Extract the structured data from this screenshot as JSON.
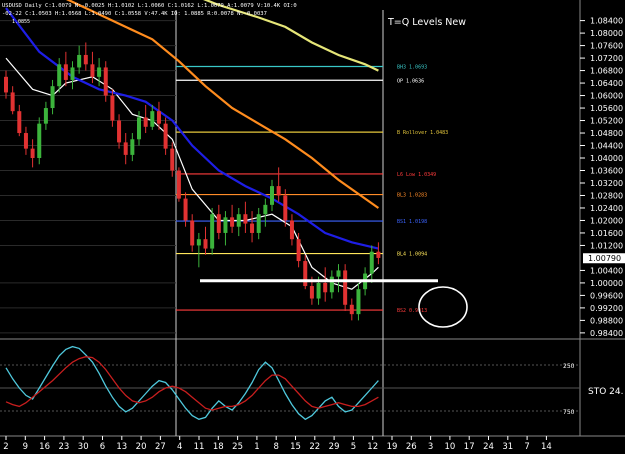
{
  "header": {
    "symbol_line": "USDUSD Daily C:1.0079 N:-0.0025 H:1.0102 L:1.0060 C:1.0162 L:1.0079 A:1.0079 V:10.4K OI:0",
    "bar_line": "-02-22 C:1.0503 H:1.0568 L:1.0490 C:1.0558 V:47.4K IO: 1.0885 R:0.0078 N:-0.0037",
    "top_left_value": "1.0855",
    "indicator_title": "T=Q Levels New"
  },
  "colors": {
    "background": "#000000",
    "up_candle": "#3cb43c",
    "down_candle": "#e13232",
    "ma_fast": "#ffffff",
    "ma_mid": "#1e1ee6",
    "ma_slow": "#ff8c1e",
    "ma_slowest": "#e6e678",
    "stoch_k": "#4fc8dc",
    "stoch_d": "#c81e1e",
    "support_line": "#ffffff",
    "circle": "#ffffff"
  },
  "chart_data": [
    {
      "type": "candlestick",
      "title": "",
      "ylim": [
        0.983,
        1.0906
      ],
      "y_ticks": [
        "1.08400",
        "1.08000",
        "1.07600",
        "1.07200",
        "1.06800",
        "1.06400",
        "1.06000",
        "1.05600",
        "1.05200",
        "1.04800",
        "1.04400",
        "1.04000",
        "1.03600",
        "1.03200",
        "1.02800",
        "1.02400",
        "1.02000",
        "1.01600",
        "1.01200",
        "1.00400",
        "1.00000",
        "0.99600",
        "0.99200",
        "0.98800",
        "0.98400"
      ],
      "y_tick_values": [
        1.084,
        1.08,
        1.076,
        1.072,
        1.068,
        1.064,
        1.06,
        1.056,
        1.052,
        1.048,
        1.044,
        1.04,
        1.036,
        1.032,
        1.028,
        1.024,
        1.02,
        1.016,
        1.012,
        1.004,
        1.0,
        0.996,
        0.992,
        0.988,
        0.984
      ],
      "last_price_label": "1.00790",
      "last_price": 1.0079,
      "candles": [
        {
          "o": 1.066,
          "h": 1.068,
          "l": 1.059,
          "c": 1.061
        },
        {
          "o": 1.061,
          "h": 1.063,
          "l": 1.054,
          "c": 1.055
        },
        {
          "o": 1.055,
          "h": 1.057,
          "l": 1.047,
          "c": 1.048
        },
        {
          "o": 1.048,
          "h": 1.05,
          "l": 1.041,
          "c": 1.043
        },
        {
          "o": 1.043,
          "h": 1.046,
          "l": 1.037,
          "c": 1.04
        },
        {
          "o": 1.04,
          "h": 1.053,
          "l": 1.038,
          "c": 1.051
        },
        {
          "o": 1.051,
          "h": 1.058,
          "l": 1.049,
          "c": 1.056
        },
        {
          "o": 1.056,
          "h": 1.065,
          "l": 1.054,
          "c": 1.063
        },
        {
          "o": 1.063,
          "h": 1.072,
          "l": 1.061,
          "c": 1.07
        },
        {
          "o": 1.07,
          "h": 1.074,
          "l": 1.063,
          "c": 1.065
        },
        {
          "o": 1.065,
          "h": 1.071,
          "l": 1.062,
          "c": 1.069
        },
        {
          "o": 1.069,
          "h": 1.076,
          "l": 1.067,
          "c": 1.073
        },
        {
          "o": 1.073,
          "h": 1.077,
          "l": 1.068,
          "c": 1.07
        },
        {
          "o": 1.07,
          "h": 1.074,
          "l": 1.064,
          "c": 1.066
        },
        {
          "o": 1.066,
          "h": 1.072,
          "l": 1.063,
          "c": 1.069
        },
        {
          "o": 1.069,
          "h": 1.071,
          "l": 1.058,
          "c": 1.06
        },
        {
          "o": 1.06,
          "h": 1.062,
          "l": 1.05,
          "c": 1.052
        },
        {
          "o": 1.052,
          "h": 1.054,
          "l": 1.043,
          "c": 1.045
        },
        {
          "o": 1.045,
          "h": 1.048,
          "l": 1.038,
          "c": 1.041
        },
        {
          "o": 1.041,
          "h": 1.048,
          "l": 1.039,
          "c": 1.046
        },
        {
          "o": 1.046,
          "h": 1.055,
          "l": 1.044,
          "c": 1.053
        },
        {
          "o": 1.053,
          "h": 1.057,
          "l": 1.048,
          "c": 1.05
        },
        {
          "o": 1.05,
          "h": 1.057,
          "l": 1.049,
          "c": 1.055
        },
        {
          "o": 1.055,
          "h": 1.058,
          "l": 1.049,
          "c": 1.051
        },
        {
          "o": 1.051,
          "h": 1.053,
          "l": 1.041,
          "c": 1.043
        },
        {
          "o": 1.043,
          "h": 1.045,
          "l": 1.034,
          "c": 1.036
        },
        {
          "o": 1.036,
          "h": 1.037,
          "l": 1.026,
          "c": 1.027
        },
        {
          "o": 1.027,
          "h": 1.029,
          "l": 1.018,
          "c": 1.02
        },
        {
          "o": 1.02,
          "h": 1.022,
          "l": 1.01,
          "c": 1.012
        },
        {
          "o": 1.012,
          "h": 1.016,
          "l": 1.005,
          "c": 1.014
        },
        {
          "o": 1.014,
          "h": 1.018,
          "l": 1.009,
          "c": 1.011
        },
        {
          "o": 1.011,
          "h": 1.024,
          "l": 1.009,
          "c": 1.022
        },
        {
          "o": 1.022,
          "h": 1.025,
          "l": 1.014,
          "c": 1.016
        },
        {
          "o": 1.016,
          "h": 1.023,
          "l": 1.012,
          "c": 1.021
        },
        {
          "o": 1.021,
          "h": 1.025,
          "l": 1.016,
          "c": 1.018
        },
        {
          "o": 1.018,
          "h": 1.024,
          "l": 1.015,
          "c": 1.022
        },
        {
          "o": 1.022,
          "h": 1.026,
          "l": 1.016,
          "c": 1.019
        },
        {
          "o": 1.019,
          "h": 1.023,
          "l": 1.013,
          "c": 1.016
        },
        {
          "o": 1.016,
          "h": 1.024,
          "l": 1.014,
          "c": 1.022
        },
        {
          "o": 1.022,
          "h": 1.027,
          "l": 1.018,
          "c": 1.025
        },
        {
          "o": 1.025,
          "h": 1.033,
          "l": 1.023,
          "c": 1.031
        },
        {
          "o": 1.031,
          "h": 1.037,
          "l": 1.026,
          "c": 1.028
        },
        {
          "o": 1.028,
          "h": 1.03,
          "l": 1.018,
          "c": 1.02
        },
        {
          "o": 1.02,
          "h": 1.022,
          "l": 1.012,
          "c": 1.014
        },
        {
          "o": 1.014,
          "h": 1.016,
          "l": 1.005,
          "c": 1.007
        },
        {
          "o": 1.007,
          "h": 1.009,
          "l": 0.998,
          "c": 0.999
        },
        {
          "o": 0.999,
          "h": 1.002,
          "l": 0.993,
          "c": 0.995
        },
        {
          "o": 0.995,
          "h": 1.002,
          "l": 0.993,
          "c": 1.0
        },
        {
          "o": 1.0,
          "h": 1.005,
          "l": 0.994,
          "c": 0.997
        },
        {
          "o": 0.997,
          "h": 1.004,
          "l": 0.995,
          "c": 1.002
        },
        {
          "o": 1.002,
          "h": 1.006,
          "l": 0.997,
          "c": 1.004
        },
        {
          "o": 1.004,
          "h": 1.006,
          "l": 0.991,
          "c": 0.993
        },
        {
          "o": 0.993,
          "h": 0.995,
          "l": 0.988,
          "c": 0.99
        },
        {
          "o": 0.99,
          "h": 1.0,
          "l": 0.988,
          "c": 0.998
        },
        {
          "o": 0.998,
          "h": 1.005,
          "l": 0.996,
          "c": 1.003
        },
        {
          "o": 1.003,
          "h": 1.012,
          "l": 1.0,
          "c": 1.01
        },
        {
          "o": 1.01,
          "h": 1.013,
          "l": 1.006,
          "c": 1.008
        }
      ],
      "moving_averages": [
        {
          "name": "",
          "color_key": "ma_fast",
          "points": [
            [
              0,
              1.072
            ],
            [
              4,
              1.062
            ],
            [
              7,
              1.06
            ],
            [
              9,
              1.064
            ],
            [
              13,
              1.066
            ],
            [
              16,
              1.062
            ],
            [
              19,
              1.054
            ],
            [
              22,
              1.052
            ],
            [
              25,
              1.046
            ],
            [
              28,
              1.03
            ],
            [
              32,
              1.02
            ],
            [
              36,
              1.02
            ],
            [
              40,
              1.022
            ],
            [
              43,
              1.018
            ],
            [
              46,
              1.005
            ],
            [
              49,
              1.0
            ],
            [
              52,
              0.998
            ],
            [
              55,
              1.003
            ],
            [
              56,
              1.005
            ]
          ]
        },
        {
          "name": "",
          "color_key": "ma_mid",
          "points": [
            [
              0,
              1.088
            ],
            [
              5,
              1.074
            ],
            [
              10,
              1.066
            ],
            [
              14,
              1.062
            ],
            [
              18,
              1.06
            ],
            [
              21,
              1.058
            ],
            [
              25,
              1.052
            ],
            [
              28,
              1.044
            ],
            [
              32,
              1.036
            ],
            [
              36,
              1.031
            ],
            [
              40,
              1.027
            ],
            [
              44,
              1.022
            ],
            [
              48,
              1.016
            ],
            [
              52,
              1.013
            ],
            [
              56,
              1.011
            ]
          ]
        },
        {
          "name": "",
          "color_key": "ma_slow",
          "points": [
            [
              0,
              1.1
            ],
            [
              6,
              1.094
            ],
            [
              12,
              1.088
            ],
            [
              18,
              1.082
            ],
            [
              22,
              1.078
            ],
            [
              26,
              1.071
            ],
            [
              30,
              1.063
            ],
            [
              34,
              1.056
            ],
            [
              38,
              1.051
            ],
            [
              42,
              1.046
            ],
            [
              46,
              1.04
            ],
            [
              50,
              1.033
            ],
            [
              54,
              1.027
            ],
            [
              56,
              1.024
            ]
          ]
        },
        {
          "name": "",
          "color_key": "ma_slowest",
          "points": [
            [
              26,
              1.094
            ],
            [
              32,
              1.089
            ],
            [
              38,
              1.085
            ],
            [
              42,
              1.082
            ],
            [
              46,
              1.077
            ],
            [
              50,
              1.073
            ],
            [
              54,
              1.07
            ],
            [
              56,
              1.068
            ]
          ]
        }
      ],
      "support_level": 1.0007,
      "levels": [
        {
          "label": "BH3 1.0693",
          "value": 1.0693,
          "color": "#39c8c8"
        },
        {
          "label": "OP 1.0636",
          "value": 1.0649,
          "color": "#ffffff"
        },
        {
          "label": "B Rollover 1.0483",
          "value": 1.0483,
          "color": "#e6c83c"
        },
        {
          "label": "L6 Low 1.0349",
          "value": 1.0349,
          "color": "#ff3c3c"
        },
        {
          "label": "BL3 1.0283",
          "value": 1.0283,
          "color": "#ff8c28"
        },
        {
          "label": "BS1 1.0198",
          "value": 1.0198,
          "color": "#3c64ff"
        },
        {
          "label": "BL4 1.0094",
          "value": 1.0094,
          "color": "#ffe65a"
        },
        {
          "label": "BS2 0.9913",
          "value": 0.9913,
          "color": "#ff3c3c"
        }
      ]
    },
    {
      "type": "line",
      "title": "",
      "ylim": [
        0,
        100
      ],
      "y_ticks": [
        "250",
        "750"
      ],
      "y_tick_values": [
        75,
        25
      ],
      "indicator_label": "STO 24.",
      "series": [
        {
          "name": "",
          "color_key": "stoch_k",
          "values": [
            72,
            60,
            50,
            42,
            38,
            50,
            62,
            74,
            85,
            92,
            95,
            93,
            86,
            78,
            66,
            52,
            40,
            30,
            24,
            28,
            36,
            44,
            52,
            58,
            56,
            48,
            38,
            28,
            20,
            16,
            18,
            28,
            36,
            30,
            26,
            34,
            44,
            56,
            70,
            78,
            72,
            58,
            44,
            32,
            22,
            16,
            20,
            28,
            36,
            40,
            30,
            24,
            26,
            34,
            42,
            50,
            58
          ]
        },
        {
          "name": "",
          "color_key": "stoch_d",
          "values": [
            35,
            32,
            30,
            34,
            40,
            46,
            52,
            58,
            65,
            72,
            78,
            82,
            84,
            83,
            78,
            70,
            60,
            50,
            42,
            36,
            34,
            36,
            40,
            46,
            50,
            52,
            50,
            46,
            40,
            34,
            28,
            26,
            28,
            30,
            30,
            32,
            36,
            42,
            50,
            58,
            64,
            64,
            60,
            52,
            44,
            36,
            30,
            28,
            30,
            32,
            34,
            32,
            30,
            30,
            32,
            36,
            40
          ]
        }
      ]
    }
  ],
  "x_axis": {
    "labels": [
      "2",
      "9",
      "16",
      "23",
      "30",
      "6",
      "13",
      "20",
      "27",
      "4",
      "11",
      "18",
      "25",
      "1",
      "8",
      "15",
      "22",
      "29",
      "5",
      "12",
      "19",
      "26",
      "3",
      "10",
      "17",
      "24",
      "31",
      "7",
      "14"
    ]
  }
}
